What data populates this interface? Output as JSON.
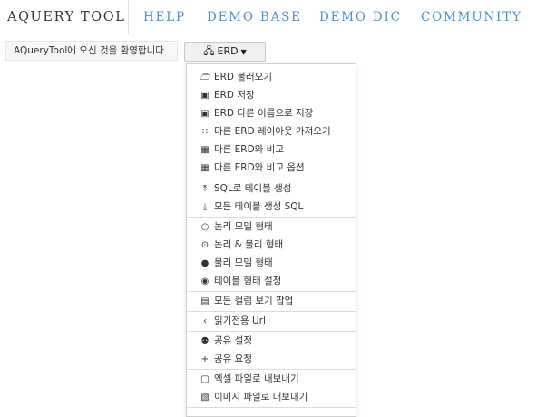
{
  "nav": {
    "brand": "AQUERY TOOL",
    "links": [
      "HELP",
      "DEMO BASE",
      "DEMO DIC",
      "COMMUNITY"
    ]
  },
  "toolbar": {
    "welcome": "AQueryTool에 오신 것을 환영합니다",
    "erd_button": "ERD"
  },
  "menu": {
    "items": [
      {
        "icon": "folder-open-icon",
        "label": "ERD 불러오기"
      },
      {
        "icon": "save-icon",
        "label": "ERD 저장"
      },
      {
        "icon": "save-as-icon",
        "label": "ERD 다른 이름으로 저장"
      },
      {
        "icon": "layout-icon",
        "label": "다른 ERD 레이아웃 가져오기"
      },
      {
        "icon": "compare-icon",
        "label": "다른 ERD와 비교"
      },
      {
        "icon": "compare-options-icon",
        "label": "다른 ERD와 비교 옵션"
      },
      {
        "icon": "upload-icon",
        "label": "SQL로 테이블 생성"
      },
      {
        "icon": "download-icon",
        "label": "모든 테이블 생성 SQL"
      },
      {
        "icon": "circle-empty-icon",
        "label": "논리 모델 형태"
      },
      {
        "icon": "circle-dot-icon",
        "label": "논리 & 물리 형태"
      },
      {
        "icon": "circle-filled-icon",
        "label": "물리 모델 형태"
      },
      {
        "icon": "eye-icon",
        "label": "테이블 형태 설정"
      },
      {
        "icon": "columns-icon",
        "label": "모든 컬럼 보기 팝업"
      },
      {
        "icon": "share-icon",
        "label": "읽기전용 Url"
      },
      {
        "icon": "users-icon",
        "label": "공유 설정"
      },
      {
        "icon": "user-add-icon",
        "label": "공유 요청"
      },
      {
        "icon": "file-excel-icon",
        "label": "엑셀 파일로 내보내기"
      },
      {
        "icon": "image-icon",
        "label": "이미지 파일로 내보내기"
      }
    ]
  }
}
